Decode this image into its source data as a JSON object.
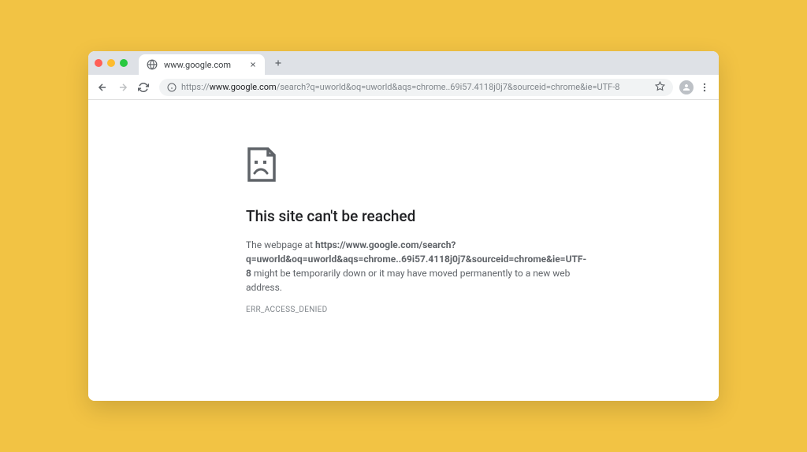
{
  "tab": {
    "title": "www.google.com"
  },
  "addressbar": {
    "prefix": "https://",
    "host": "www.google.com",
    "path": "/search?q=uworld&oq=uworld&aqs=chrome..69i57.4118j0j7&sourceid=chrome&ie=UTF-8"
  },
  "error": {
    "heading": "This site can't be reached",
    "body_prefix": "The webpage at ",
    "body_url": "https://www.google.com/search?q=uworld&oq=uworld&aqs=chrome..69i57.4118j0j7&sourceid=chrome&ie=UTF-8",
    "body_suffix": " might be temporarily down or it may have moved permanently to a new web address.",
    "code": "ERR_ACCESS_DENIED"
  }
}
